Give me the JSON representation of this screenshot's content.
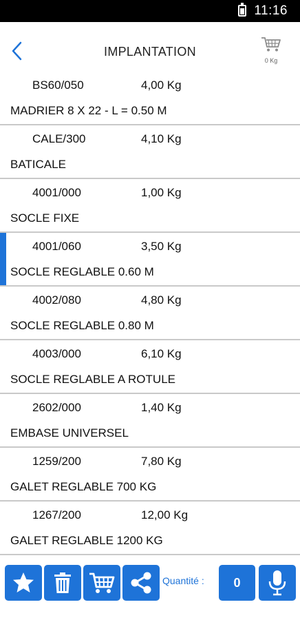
{
  "status_bar": {
    "time": "11:16"
  },
  "header": {
    "title": "IMPLANTATION",
    "cart_weight": "0 Kg"
  },
  "items": [
    {
      "ref": "BS60/050",
      "weight": "4,00 Kg",
      "label": "MADRIER  8 X 22 - L = 0.50 M"
    },
    {
      "ref": "CALE/300",
      "weight": "4,10 Kg",
      "label": "BATICALE"
    },
    {
      "ref": "4001/000",
      "weight": "1,00 Kg",
      "label": "SOCLE FIXE"
    },
    {
      "ref": "4001/060",
      "weight": "3,50 Kg",
      "label": "SOCLE REGLABLE 0.60 M"
    },
    {
      "ref": "4002/080",
      "weight": "4,80 Kg",
      "label": "SOCLE REGLABLE 0.80 M"
    },
    {
      "ref": "4003/000",
      "weight": "6,10 Kg",
      "label": "SOCLE REGLABLE A ROTULE"
    },
    {
      "ref": "2602/000",
      "weight": "1,40 Kg",
      "label": "EMBASE UNIVERSEL"
    },
    {
      "ref": "1259/200",
      "weight": "7,80 Kg",
      "label": "GALET REGLABLE 700 KG"
    },
    {
      "ref": "1267/200",
      "weight": "12,00 Kg",
      "label": "GALET REGLABLE 1200 KG"
    }
  ],
  "bottom_bar": {
    "quantity_label": "Quantité :",
    "quantity_value": "0"
  },
  "colors": {
    "accent": "#1e73d8",
    "divider": "#c9c9c9"
  }
}
